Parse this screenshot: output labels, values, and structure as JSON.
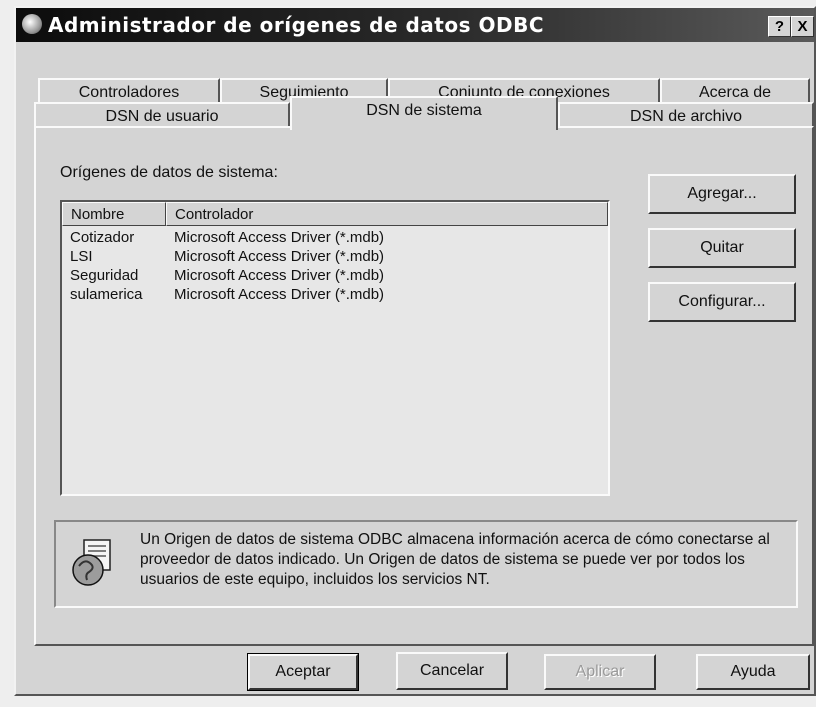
{
  "window": {
    "title": "Administrador de orígenes de datos ODBC",
    "help_button": "?",
    "close_button": "X"
  },
  "tabs_row1": [
    {
      "label": "Controladores"
    },
    {
      "label": "Seguimiento"
    },
    {
      "label": "Conjunto de conexiones"
    },
    {
      "label": "Acerca de"
    }
  ],
  "tabs_row2": [
    {
      "label": "DSN de usuario"
    },
    {
      "label": "DSN de sistema",
      "active": true
    },
    {
      "label": "DSN de archivo"
    }
  ],
  "panel": {
    "list_label": "Orígenes de datos de sistema:",
    "columns": [
      "Nombre",
      "Controlador"
    ],
    "rows": [
      {
        "name": "Cotizador",
        "driver": "Microsoft Access Driver (*.mdb)"
      },
      {
        "name": "LSI",
        "driver": "Microsoft Access Driver (*.mdb)"
      },
      {
        "name": "Seguridad",
        "driver": "Microsoft Access Driver (*.mdb)"
      },
      {
        "name": "sulamerica",
        "driver": "Microsoft Access Driver (*.mdb)"
      }
    ],
    "buttons": {
      "add": "Agregar...",
      "remove": "Quitar",
      "configure": "Configurar..."
    },
    "info_text": "Un Origen de datos de sistema ODBC almacena información acerca de cómo conectarse al proveedor de datos indicado. Un Origen de datos de sistema se puede ver por todos los usuarios de este equipo, incluidos los servicios NT."
  },
  "footer": {
    "ok": "Aceptar",
    "cancel": "Cancelar",
    "apply": "Aplicar",
    "help": "Ayuda"
  }
}
